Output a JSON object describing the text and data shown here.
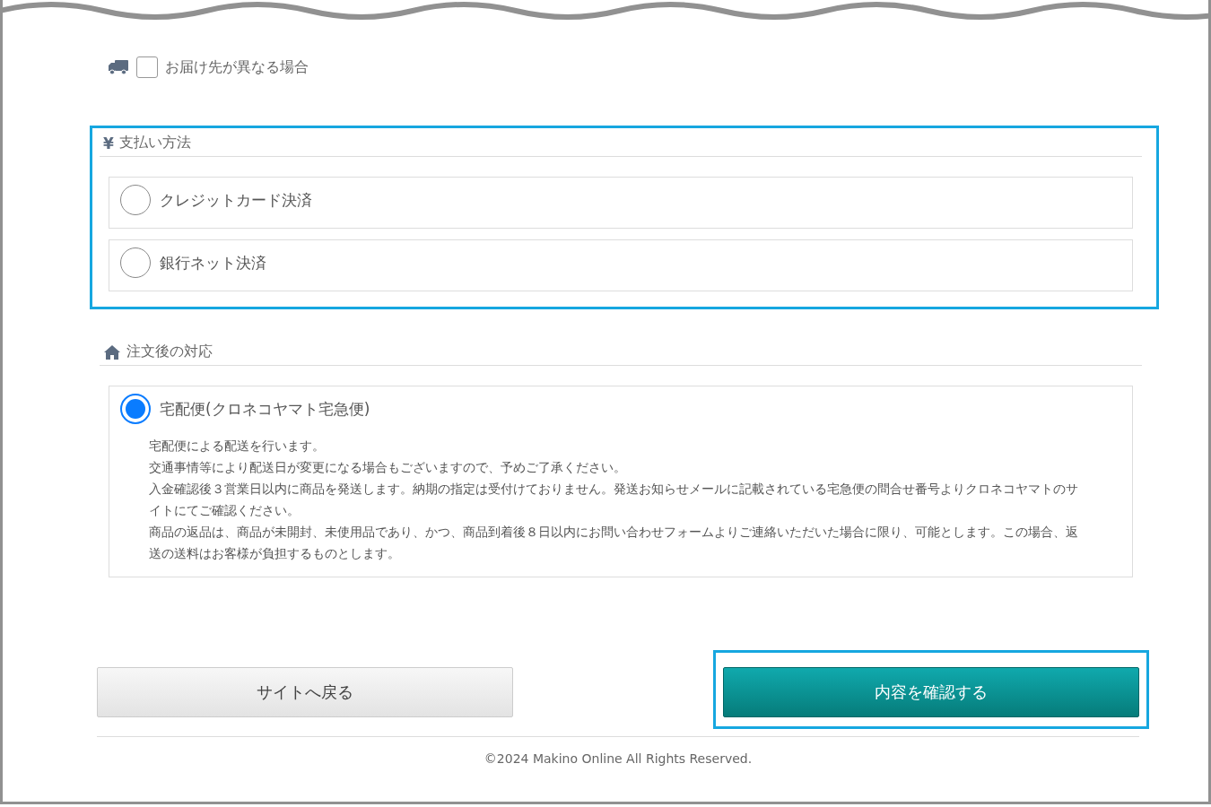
{
  "shipping_option": {
    "label": "お届け先が異なる場合",
    "checked": false
  },
  "payment": {
    "icon": "¥",
    "title": "支払い方法",
    "highlighted": true,
    "options": [
      {
        "label": "クレジットカード決済",
        "selected": false
      },
      {
        "label": "銀行ネット決済",
        "selected": false
      }
    ]
  },
  "after_order": {
    "title": "注文後の対応",
    "highlighted": false,
    "options": [
      {
        "label": "宅配便(クロネコヤマト宅急便)",
        "selected": true,
        "description": [
          "宅配便による配送を行います。",
          "交通事情等により配送日が変更になる場合もございますので、予めご了承ください。",
          "入金確認後３営業日以内に商品を発送します。納期の指定は受付けておりません。発送お知らせメールに記載されている宅急便の問合せ番号よりクロネコヤマトのサイトにてご確認ください。",
          "商品の返品は、商品が未開封、未使用品であり、かつ、商品到着後８日以内にお問い合わせフォームよりご連絡いただいた場合に限り、可能とします。この場合、返送の送料はお客様が負担するものとします。"
        ]
      }
    ]
  },
  "buttons": [
    {
      "label": "サイトへ戻る",
      "kind": "secondary",
      "highlighted": false
    },
    {
      "label": "内容を確認する",
      "kind": "primary",
      "highlighted": true
    }
  ],
  "footer": "©2024 Makino Online All Rights Reserved."
}
